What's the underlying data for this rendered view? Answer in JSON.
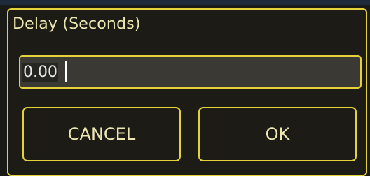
{
  "dialog": {
    "title": "Delay (Seconds)",
    "input": {
      "value": "0.00"
    },
    "buttons": {
      "cancel_label": "CANCEL",
      "ok_label": "OK"
    }
  },
  "colors": {
    "accent": "#e3d23a",
    "background": "#1c1b15",
    "field_background": "#3a3934",
    "text": "#ece6b2"
  }
}
